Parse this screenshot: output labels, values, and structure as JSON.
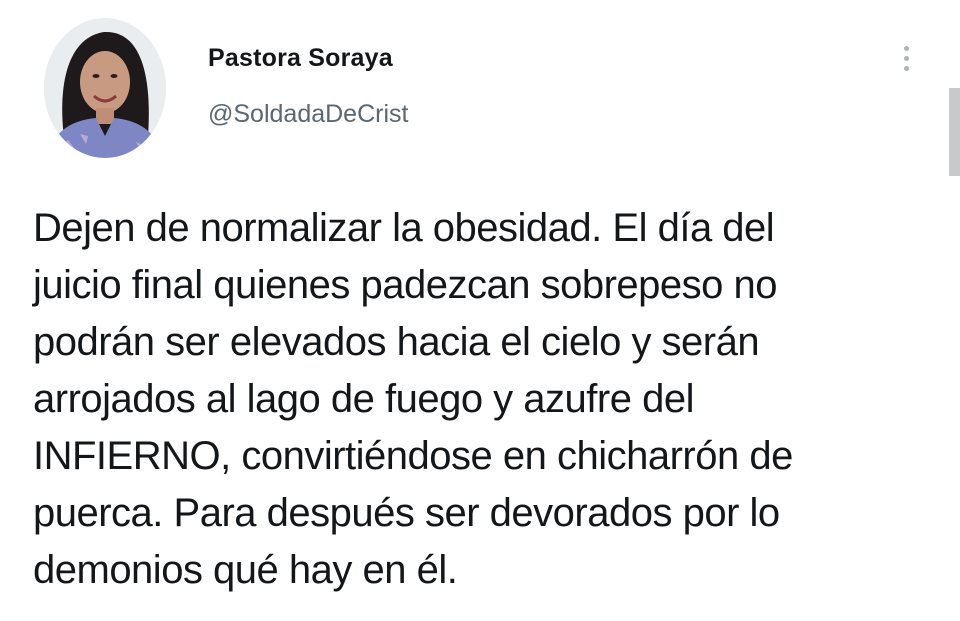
{
  "author": {
    "display_name": "Pastora Soraya",
    "handle": "@SoldadaDeCrist",
    "avatar": "profile-photo"
  },
  "actions": {
    "more_icon": "vertical-ellipsis-icon"
  },
  "tweet": {
    "lines": [
      "Dejen de normalizar la obesidad. El día del",
      "juicio final quienes padezcan sobrepeso no",
      "podrán ser elevados hacia el cielo y serán",
      "arrojados al lago de fuego y azufre del",
      "INFIERNO, convirtiéndose en chicharrón de",
      "puerca. Para después ser devorados por lo",
      "demonios qué hay en él."
    ]
  },
  "colors": {
    "text": "#14171a",
    "secondary_text": "#5b6670",
    "icon": "#aab3bb",
    "scrollbar": "#c7c9cb",
    "background": "#ffffff"
  }
}
